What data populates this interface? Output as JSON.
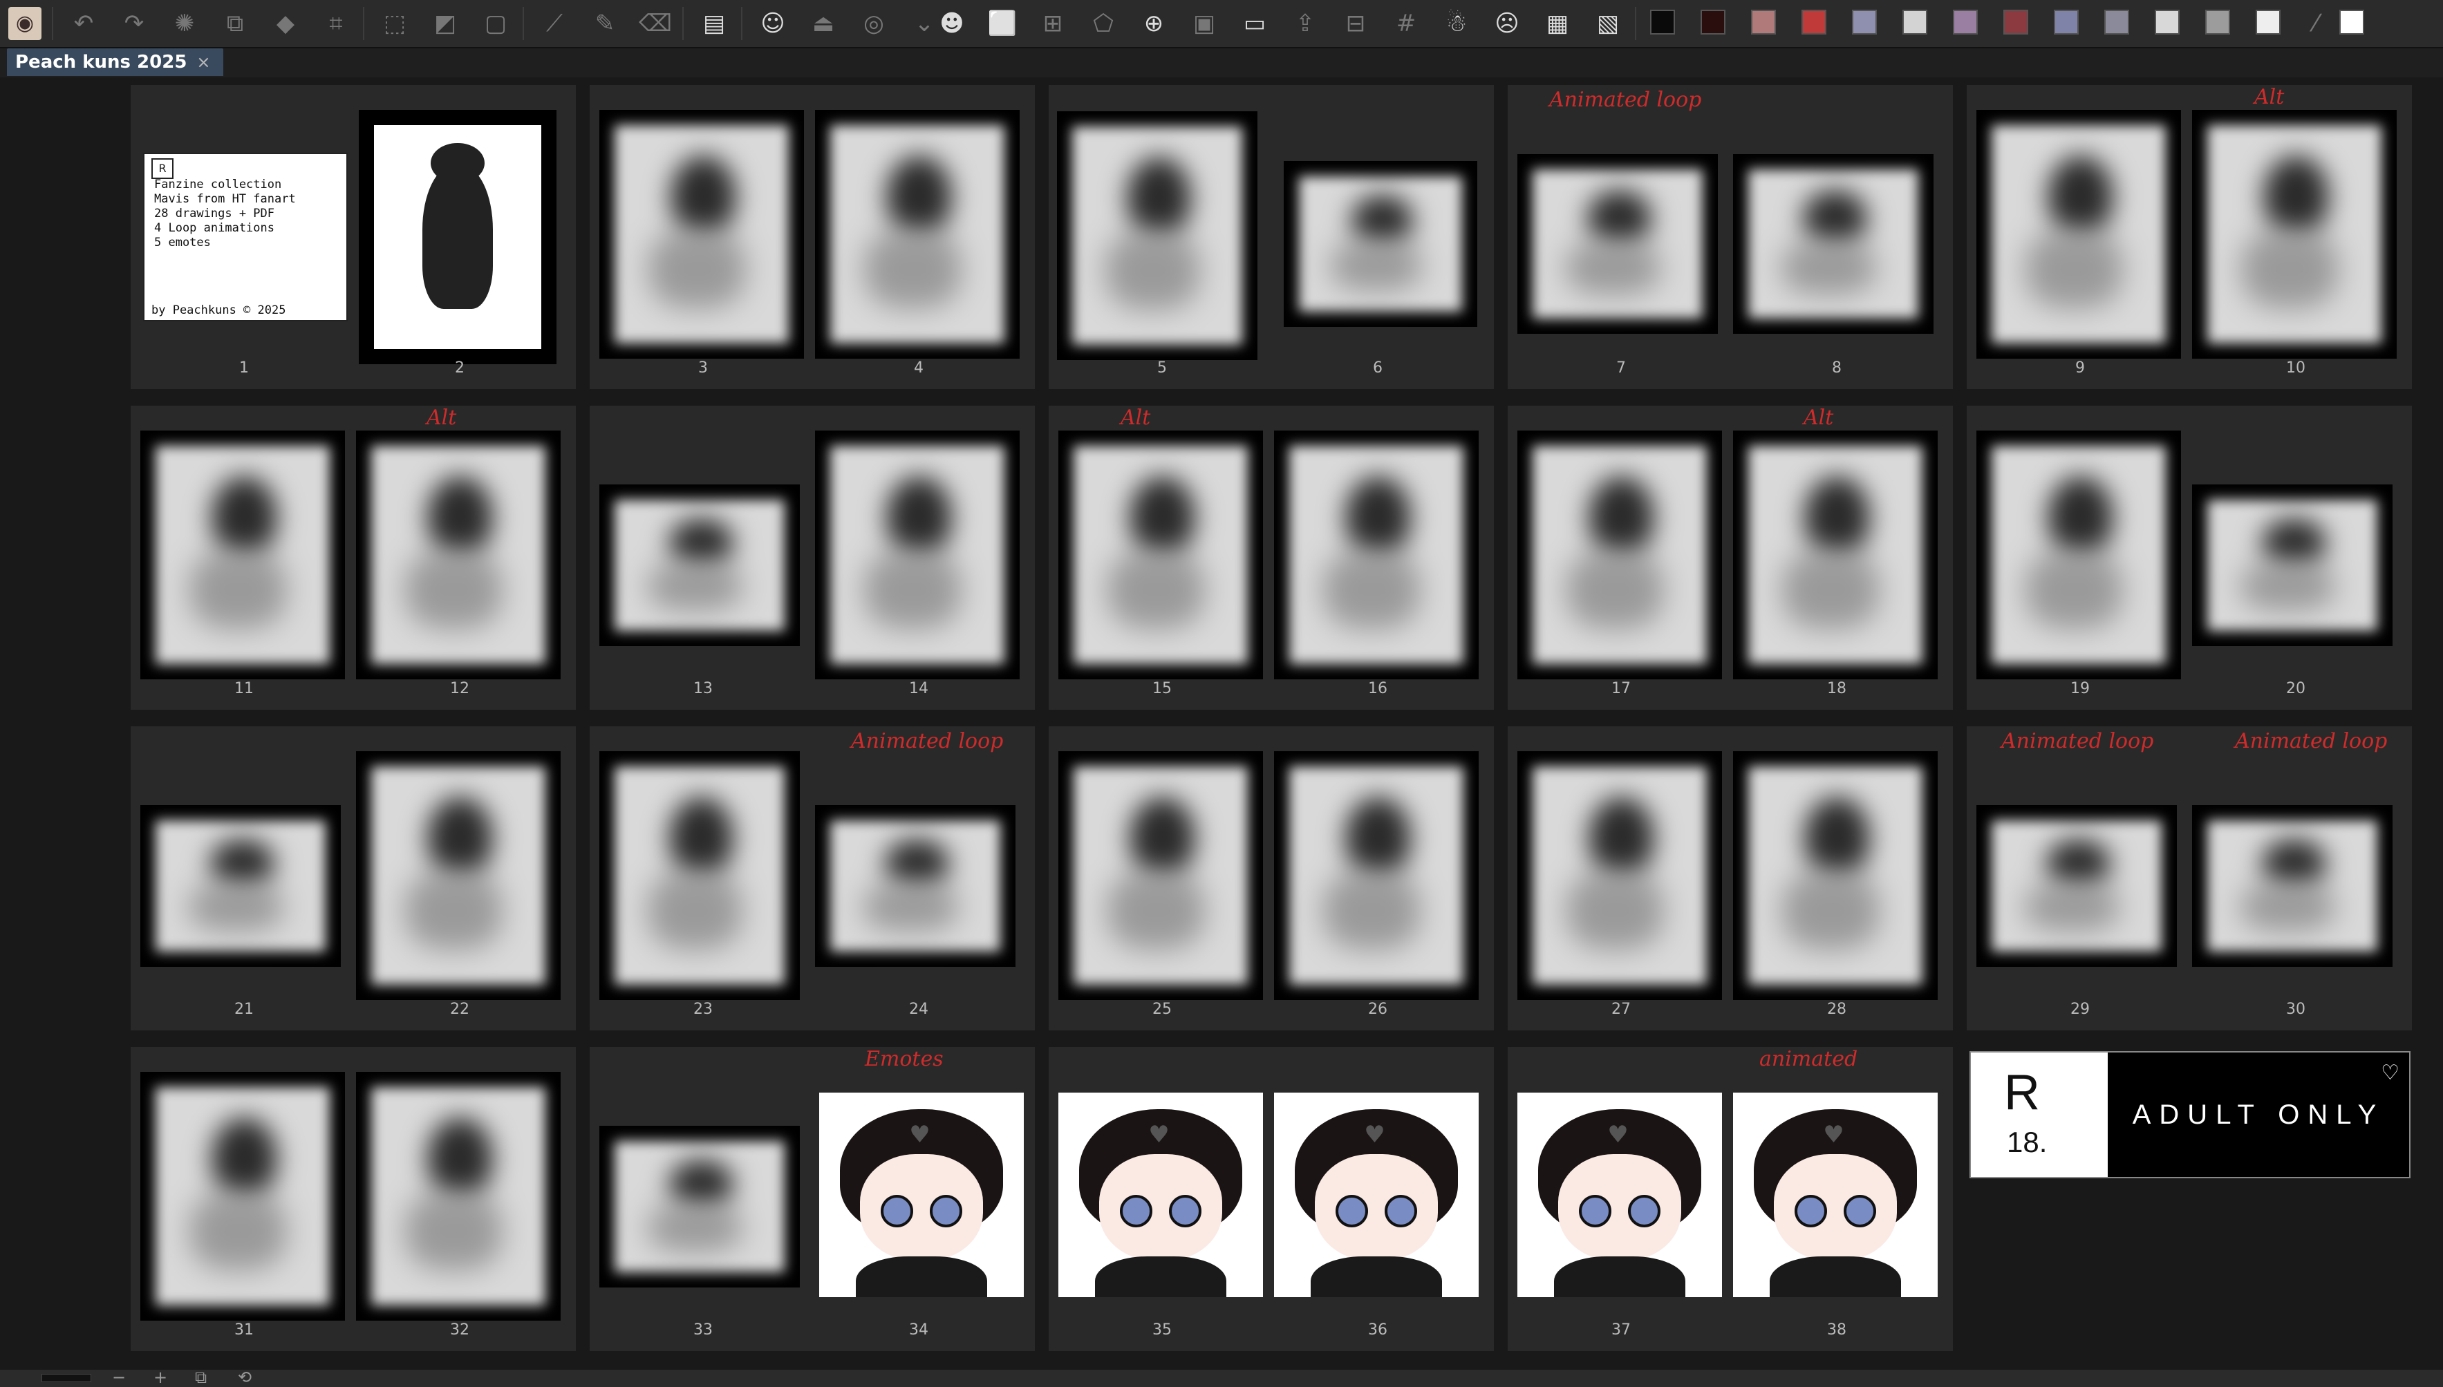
{
  "toolbar": {
    "groups": [
      [
        "app-logo-icon"
      ],
      [
        "undo-icon",
        "redo-icon",
        "loading-icon",
        "transform-icon",
        "fill-icon",
        "crop-icon"
      ],
      [
        "deselect-icon",
        "invert-selection-icon",
        "selection-border-icon"
      ],
      [
        "ruler-line-icon",
        "pen-icon",
        "eraser-icon"
      ],
      [
        "panel-icon"
      ],
      [
        "character-icon",
        "export-icon",
        "record-icon",
        "chevron-down-icon",
        "reference-icon",
        "frame-icon",
        "mesh-icon",
        "distort-icon",
        "new-page-icon",
        "page-settings-icon",
        "folder-icon",
        "upload-icon",
        "split-icon",
        "grid-icon",
        "model-icon",
        "character-2-icon",
        "png-export-icon",
        "jpg-export-icon"
      ],
      [
        "colors"
      ]
    ],
    "swatches": [
      "#0a0a0a",
      "#2a0e0e",
      "#b07a7a",
      "#c13a3a",
      "#8f8fb0",
      "#d3d3d3",
      "#9a7fa3",
      "#8c3a3f",
      "#7f83a8",
      "#8a8a9a",
      "#d8d8d8",
      "#9c9c9c",
      "#eeeeee",
      "#ffffff"
    ]
  },
  "tab": {
    "title": "Peach kuns  2025",
    "close": "×"
  },
  "cover": {
    "logo": "R",
    "lines": [
      "Fanzine collection",
      "Mavis from HT fanart",
      "28 drawings + PDF",
      "4 Loop animations",
      "5 emotes"
    ],
    "by": "by Peachkuns © 2025"
  },
  "pages": [
    "1",
    "2",
    "3",
    "4",
    "5",
    "6",
    "7",
    "8",
    "9",
    "10",
    "11",
    "12",
    "13",
    "14",
    "15",
    "16",
    "17",
    "18",
    "19",
    "20",
    "21",
    "22",
    "23",
    "24",
    "25",
    "26",
    "27",
    "28",
    "29",
    "30",
    "31",
    "32",
    "33",
    "34",
    "35",
    "36",
    "37",
    "38"
  ],
  "notes": {
    "animated_loop": "Animated loop",
    "alt": "Alt",
    "emotes": "Emotes",
    "animated": "animated"
  },
  "r18": {
    "R": "R",
    "n18": "18.",
    "label": "ADULT ONLY"
  },
  "status": {
    "minus": "−",
    "plus": "+"
  }
}
